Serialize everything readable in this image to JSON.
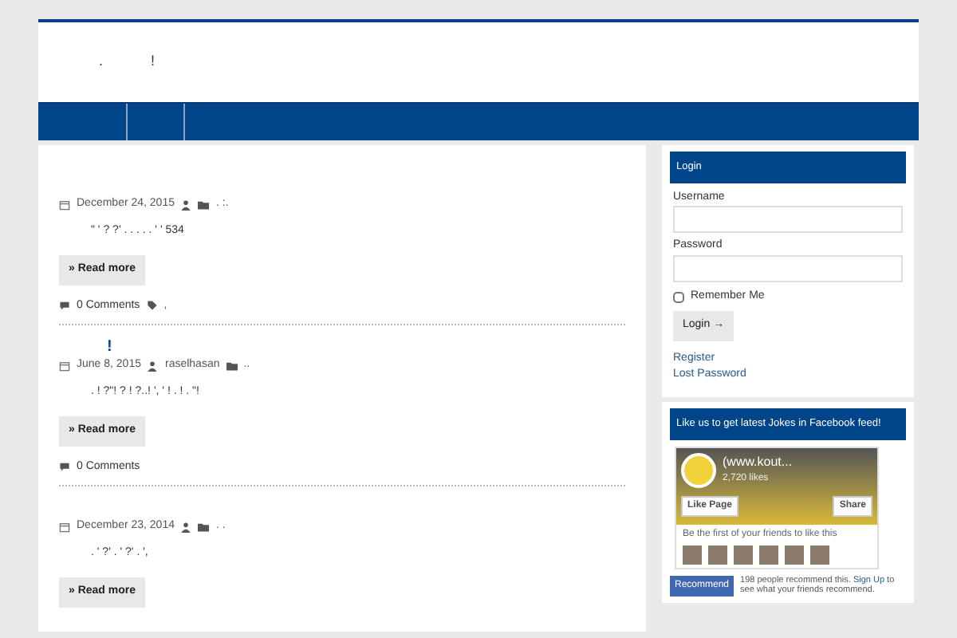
{
  "header": {
    "title_marks": [
      ".",
      "!"
    ]
  },
  "posts": [
    {
      "date": "December 24, 2015",
      "category": ". :.",
      "excerpt": "\" ' ? ?' . . . . . ' ' 534",
      "read_more": "» Read more",
      "comments": "0 Comments",
      "tags": ","
    },
    {
      "title": "!",
      "date": "June 8, 2015",
      "author": "raselhasan",
      "category": "..",
      "excerpt": ". ! ?\"! ? ! ?..! ', ' ! . ! . \"!",
      "read_more": "» Read more",
      "comments": "0 Comments"
    },
    {
      "date": "December 23, 2014",
      "category": ". .",
      "excerpt": ". ' ?' . ' ?' . ',",
      "read_more": "» Read more"
    }
  ],
  "login": {
    "title": "Login",
    "username_label": "Username",
    "password_label": "Password",
    "remember_label": "Remember Me",
    "remember_checked": false,
    "button": "Login →",
    "links": [
      "Register",
      "Lost Password"
    ]
  },
  "facebook": {
    "title": "Like us to get latest Jokes in Facebook feed!",
    "page_name": "(www.kout...",
    "likes": "2,720 likes",
    "like_button": "Like Page",
    "share_button": "Share",
    "friends_text": "Be the first of your friends to like this",
    "recommend_button": "Recommend",
    "recommend_text": "198 people recommend this.",
    "signup_link": "Sign Up",
    "recommend_tail": "to see what your friends recommend."
  }
}
